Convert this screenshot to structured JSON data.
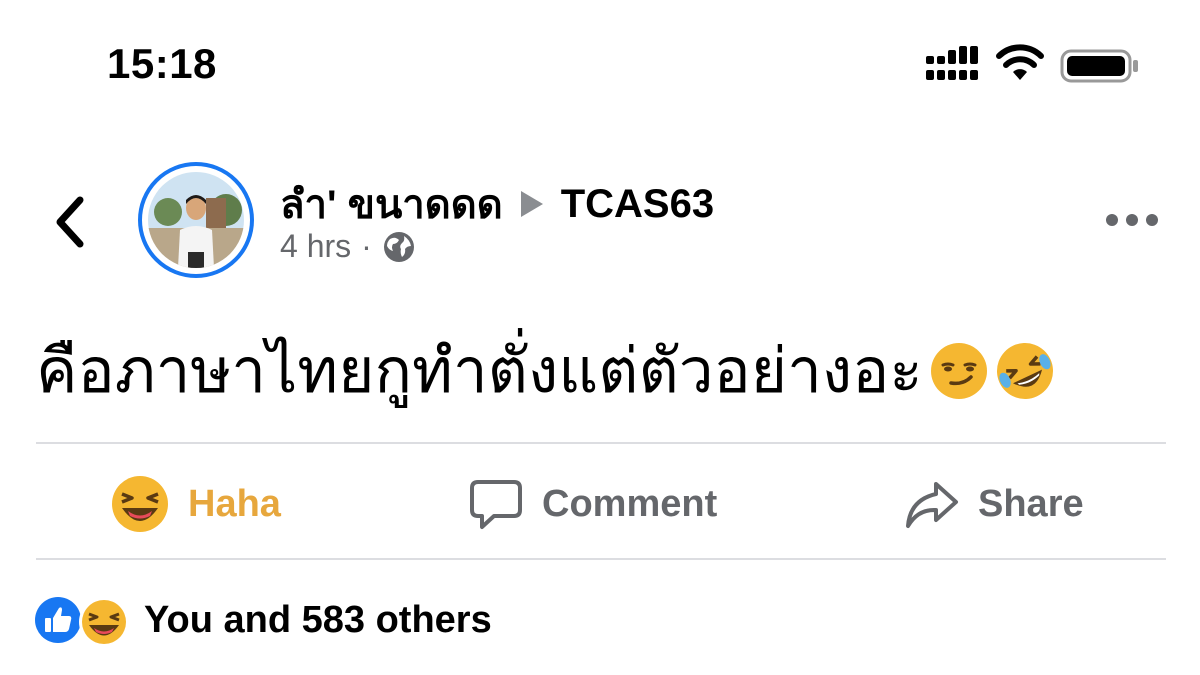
{
  "status_bar": {
    "time": "15:18",
    "icons": [
      "cellular-signal-icon",
      "wifi-icon",
      "battery-icon"
    ]
  },
  "post": {
    "author": "ลำ' ขนาดดด",
    "target": "TCAS63",
    "timestamp": "4 hrs",
    "separator": "·",
    "privacy_icon": "globe-icon",
    "text": "คือภาษาไทยกูทำตั่งแต่ตัวอย่างอะ",
    "text_emojis": [
      "smirking-face-emoji",
      "rolling-on-floor-laughing-emoji"
    ]
  },
  "actions": {
    "haha_label": "Haha",
    "comment_label": "Comment",
    "share_label": "Share"
  },
  "reactions": {
    "summary": "You and 583 others",
    "icons": [
      "like-reaction-icon",
      "haha-reaction-icon"
    ]
  },
  "colors": {
    "accent_blue": "#1877f2",
    "haha_yellow": "#e7a73d",
    "secondary_text": "#65676b",
    "divider": "#dcdde1"
  }
}
